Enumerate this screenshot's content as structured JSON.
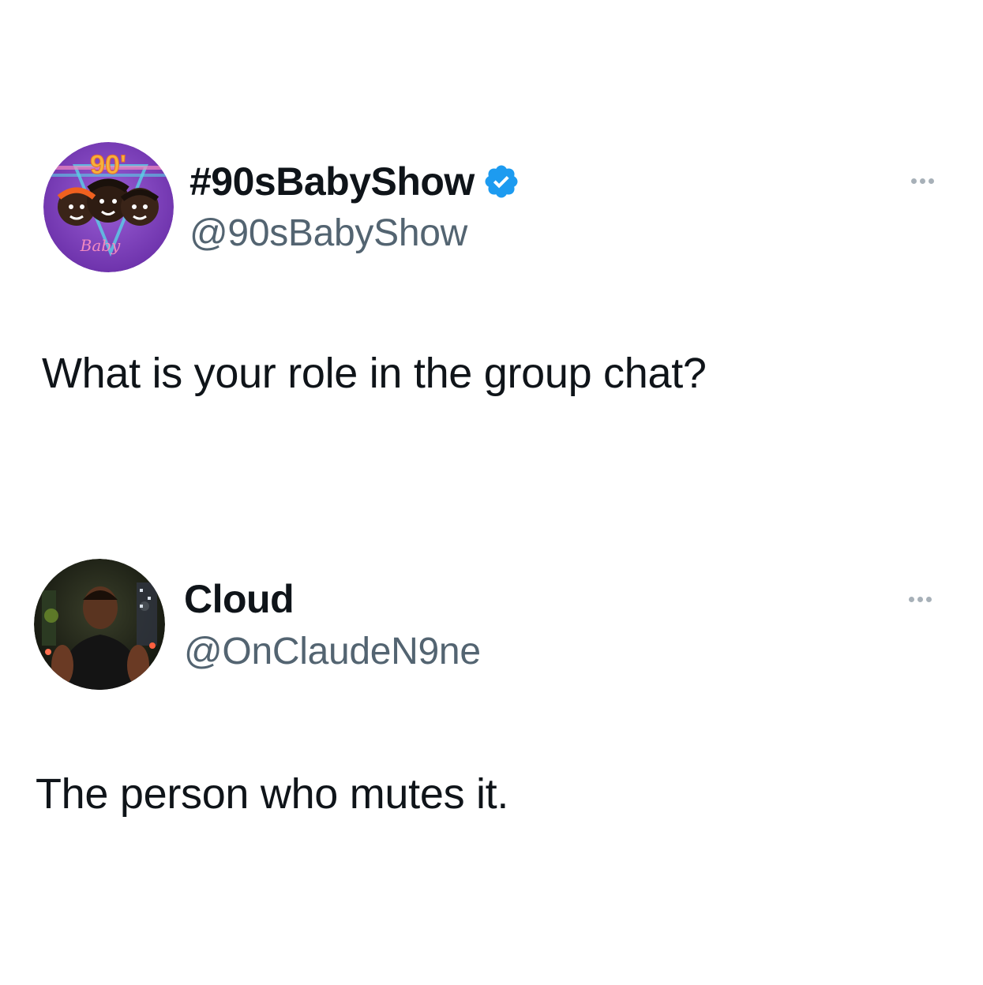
{
  "tweets": [
    {
      "display_name": "#90sBabyShow",
      "handle": "@90sBabyShow",
      "verified": true,
      "avatar_icon": "90s-baby-show-logo",
      "avatar_text": "90'",
      "avatar_script": "Baby",
      "text": "What is your role in the group chat?"
    },
    {
      "display_name": "Cloud",
      "handle": "@OnClaudeN9ne",
      "verified": false,
      "avatar_icon": "profile-photo",
      "text": "The person who mutes it."
    }
  ],
  "colors": {
    "text_primary": "#0f1419",
    "text_secondary": "#536471",
    "verified_blue": "#1d9bf0",
    "avatar_purple": "#7b3fb8",
    "more_dots": "#a7b0b8"
  }
}
